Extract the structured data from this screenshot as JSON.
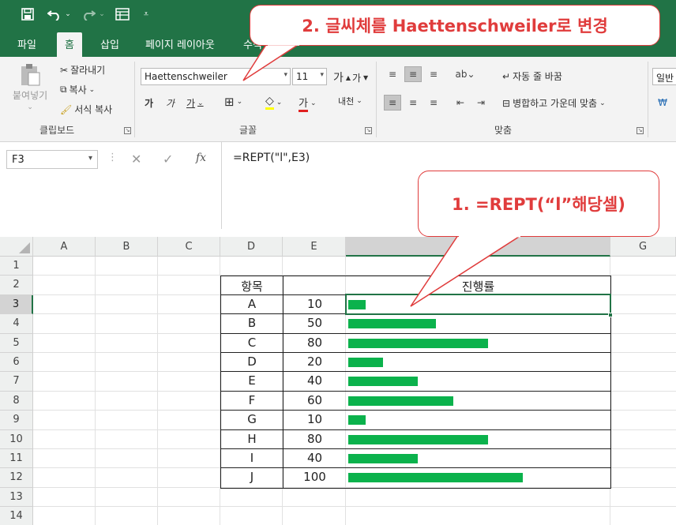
{
  "qat": {
    "save_icon": "save-icon",
    "undo_icon": "undo-icon",
    "redo_icon": "redo-icon",
    "form_icon": "form-icon",
    "customize_icon": "customize-icon"
  },
  "tabs": [
    {
      "label": "파일"
    },
    {
      "label": "홈"
    },
    {
      "label": "삽입"
    },
    {
      "label": "페이지 레이아웃"
    },
    {
      "label": "수식"
    }
  ],
  "ribbon": {
    "clipboard": {
      "paste": "붙여넣기",
      "cut": "잘라내기",
      "copy": "복사",
      "format_painter": "서식 복사",
      "label": "클립보드"
    },
    "font": {
      "name": "Haettenschweiler",
      "size": "11",
      "grow": "가",
      "shrink": "가",
      "bold": "가",
      "italic": "가",
      "underline": "가",
      "phonetic": "내천",
      "label": "글꼴"
    },
    "alignment": {
      "wrap": "자동 줄 바꿈",
      "merge": "병합하고 가운데 맞춤",
      "label": "맞춤"
    },
    "number": {
      "format": "일반"
    }
  },
  "formula_bar": {
    "name_box": "F3",
    "fx": "fx",
    "cancel": "✕",
    "enter": "✓",
    "formula": "=REPT(\"l\",E3)"
  },
  "grid": {
    "columns": [
      "A",
      "B",
      "C",
      "D",
      "E",
      "F",
      "G"
    ],
    "active_column": "F",
    "rows": [
      "1",
      "2",
      "3",
      "4",
      "5",
      "6",
      "7",
      "8",
      "9",
      "10",
      "11",
      "12",
      "13",
      "14"
    ],
    "active_row": "3",
    "header_item": "항목",
    "header_progress": "진행률",
    "items": [
      {
        "label": "A",
        "value": "10",
        "pct": 10
      },
      {
        "label": "B",
        "value": "50",
        "pct": 50
      },
      {
        "label": "C",
        "value": "80",
        "pct": 80
      },
      {
        "label": "D",
        "value": "20",
        "pct": 20
      },
      {
        "label": "E",
        "value": "40",
        "pct": 40
      },
      {
        "label": "F",
        "value": "60",
        "pct": 60
      },
      {
        "label": "G",
        "value": "10",
        "pct": 10
      },
      {
        "label": "H",
        "value": "80",
        "pct": 80
      },
      {
        "label": "I",
        "value": "40",
        "pct": 40
      },
      {
        "label": "J",
        "value": "100",
        "pct": 100
      }
    ]
  },
  "callouts": {
    "step2": "2. 글씨체를 Haettenschweiler로 변경",
    "step1": "1. =REPT(“l”해당셀)"
  },
  "colors": {
    "excel_green": "#217346",
    "bar_green": "#0bb24c",
    "callout_red": "#e03c3c"
  }
}
